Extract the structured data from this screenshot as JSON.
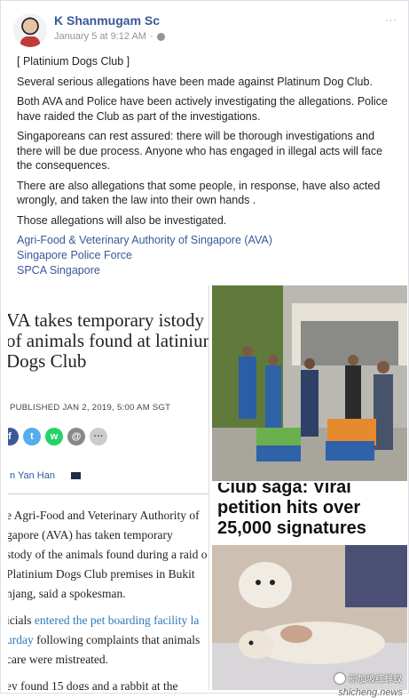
{
  "post": {
    "author": "K Shanmugam Sc",
    "timestamp": "January 5 at 9:12 AM",
    "menu": "···",
    "paragraphs": [
      "[ Platinium Dogs Club ]",
      "Several serious allegations have been made against Platinum Dog Club.",
      "Both AVA and Police have been actively investigating the allegations. Police have raided the Club as part of the investigations.",
      "Singaporeans can rest assured: there will be thorough investigations and there will be due process. Anyone who has engaged in illegal acts will face the consequences.",
      "There are also allegations that some people, in response, have also acted wrongly, and taken the law into their own hands .",
      "Those allegations will also be investigated."
    ],
    "tagged_pages": [
      "Agri-Food & Veterinary Authority of Singapore (AVA)",
      "Singapore Police Force",
      "SPCA Singapore"
    ]
  },
  "article": {
    "headline": "VA takes temporary istody of animals found at latinium Dogs Club",
    "published": "PUBLISHED  JAN 2, 2019, 5:00 AM SGT",
    "author": "n Yan Han",
    "body_lines": [
      "e Agri-Food and Veterinary Authority of",
      "gapore (AVA) has taken temporary",
      "stody of the animals found during a raid o",
      "Platinium Dogs Club premises in Bukit",
      "njang, said a spokesman."
    ],
    "body2_plain_1": "icials ",
    "body2_link_1": "entered the pet boarding facility la",
    "body2_link_2": "urday",
    "body2_plain_2": " following complaints that animals",
    "body2_line3": "care were mistreated.",
    "body3": "ey found 15 dogs and a rabbit at the"
  },
  "photo2": {
    "headline_line1": "Club saga: Viral",
    "headline_line2": "petition hits over",
    "headline_line3": "25,000 signatures"
  },
  "watermark": {
    "text": "新加坡红蝉蚁",
    "domain": "shicheng.news"
  },
  "colors": {
    "link": "#385898",
    "text": "#1d2129",
    "meta": "#90949c"
  }
}
